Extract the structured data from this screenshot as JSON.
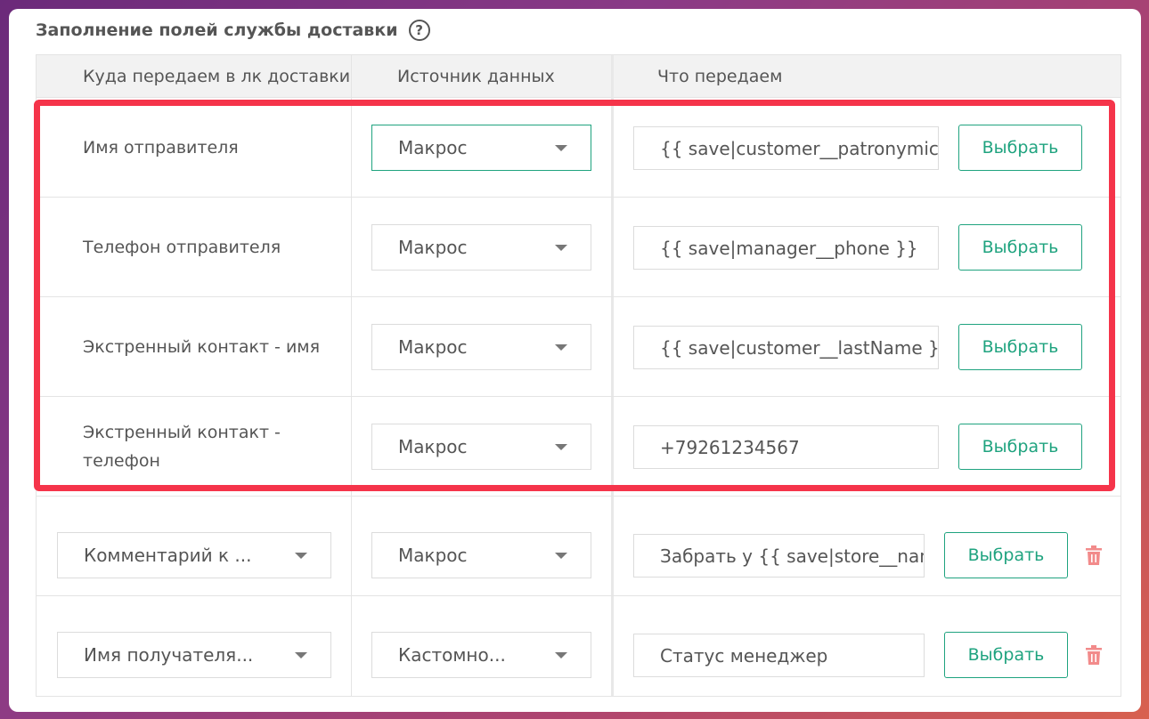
{
  "section": {
    "title": "Заполнение полей службы доставки",
    "help_icon": "question-circle-icon"
  },
  "table": {
    "columns": [
      "Куда передаем в лк доставки",
      "Источник данных",
      "Что передаем"
    ],
    "fixed_rows": [
      {
        "label_line1": "Имя отправителя",
        "label_line2": "",
        "source": "Макрос",
        "value": "{{ save|customer__patronymic }}",
        "button": "Выбрать"
      },
      {
        "label_line1": "Телефон отправителя",
        "label_line2": "",
        "source": "Макрос",
        "value": "{{ save|manager__phone }}",
        "button": "Выбрать"
      },
      {
        "label_line1": "Экстренный контакт - имя",
        "label_line2": "",
        "source": "Макрос",
        "value": "{{ save|customer__lastName }}",
        "button": "Выбрать"
      },
      {
        "label_line1": "Экстренный контакт -",
        "label_line2": "телефон",
        "source": "Макрос",
        "value": "+79261234567",
        "button": "Выбрать"
      }
    ],
    "custom_rows": [
      {
        "field": "Комментарий к ...",
        "source": "Макрос",
        "value": "Забрать у {{ save|store__nam",
        "button": "Выбрать",
        "delete_icon": "trash-icon"
      },
      {
        "field": "Имя получателя...",
        "source": "Кастомно...",
        "value": "Статус менеджер",
        "button": "Выбрать",
        "delete_icon": "trash-icon"
      }
    ]
  },
  "colors": {
    "accent": "#1fa37f",
    "highlight": "#f5344a",
    "delete": "#f28b8b"
  }
}
